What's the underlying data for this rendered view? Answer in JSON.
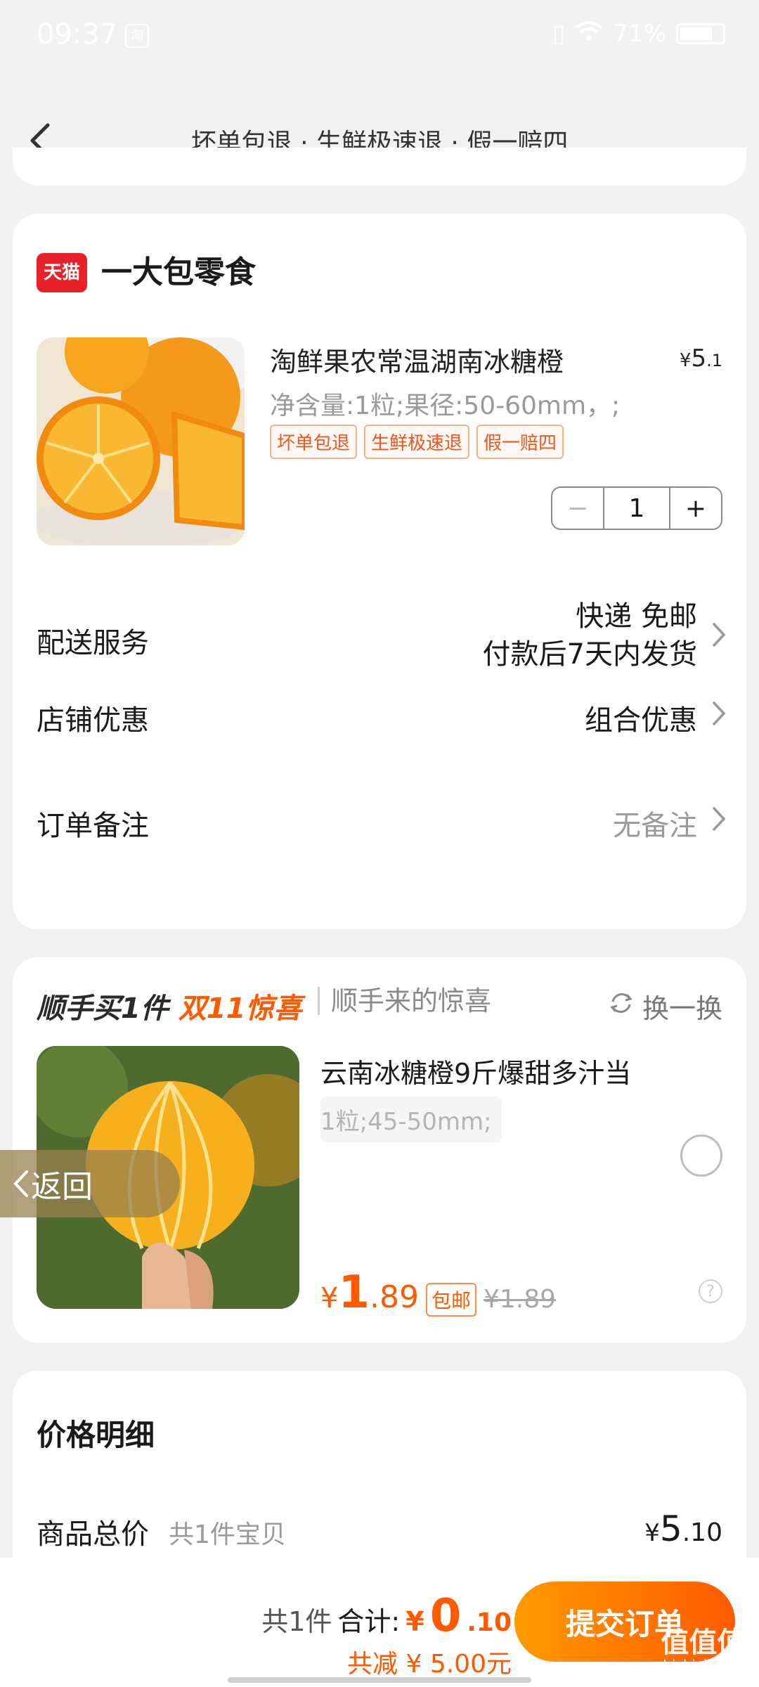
{
  "status_bar": {
    "time": "09:37",
    "app_icon": "淘",
    "battery": "71%"
  },
  "header": {
    "title": "坏单包退 · 生鲜极速退 · 假一赔四"
  },
  "shop": {
    "logo": "天猫",
    "name": "一大包零食",
    "product": {
      "title": "淘鲜果农常温湖南冰糖橙",
      "price_symbol": "¥",
      "price_int": "5",
      "price_dec": ".1",
      "spec": "净含量:1粒;果径:50-60mm，;",
      "tags": [
        "坏单包退",
        "生鲜极速退",
        "假一赔四"
      ],
      "qty_minus": "−",
      "quantity": "1",
      "qty_plus": "+"
    },
    "delivery": {
      "label": "配送服务",
      "value_line1": "快递 免邮",
      "value_line2": "付款后7天内发货"
    },
    "discount": {
      "label": "店铺优惠",
      "value": "组合优惠"
    },
    "note": {
      "label": "订单备注",
      "value": "无备注"
    }
  },
  "addon": {
    "title_prefix": "顺手买1件",
    "title_highlight": "双11惊喜",
    "subtitle": "顺手来的惊喜",
    "swap_label": "换一换",
    "product_name": "云南冰糖橙9斤爆甜多汁当",
    "spec": "1粒;45-50mm;",
    "price_symbol": "¥",
    "price_int": "1",
    "price_dec": ".89",
    "free_shipping": "包邮",
    "original_price": "¥1.89",
    "help": "?"
  },
  "float_back": {
    "label": "返回"
  },
  "price_detail": {
    "title": "价格明细",
    "total_label": "商品总价",
    "total_count": "共1件宝贝",
    "price_symbol": "¥",
    "price_int": "5",
    "price_dec": ".10"
  },
  "bottom_bar": {
    "count": "共1件",
    "sum_label": "合计:",
    "sum_symbol": "¥",
    "sum_int": "0",
    "sum_dec": ".10",
    "saving": "共减 ¥ 5.00元",
    "submit": "提交订单"
  },
  "watermark": {
    "text": "值值值",
    "sub": "zhizhizhi.com"
  },
  "colors": {
    "accent": "#ff5a00",
    "tmall_red": "#e8202a",
    "background": "#f2f2f2"
  }
}
